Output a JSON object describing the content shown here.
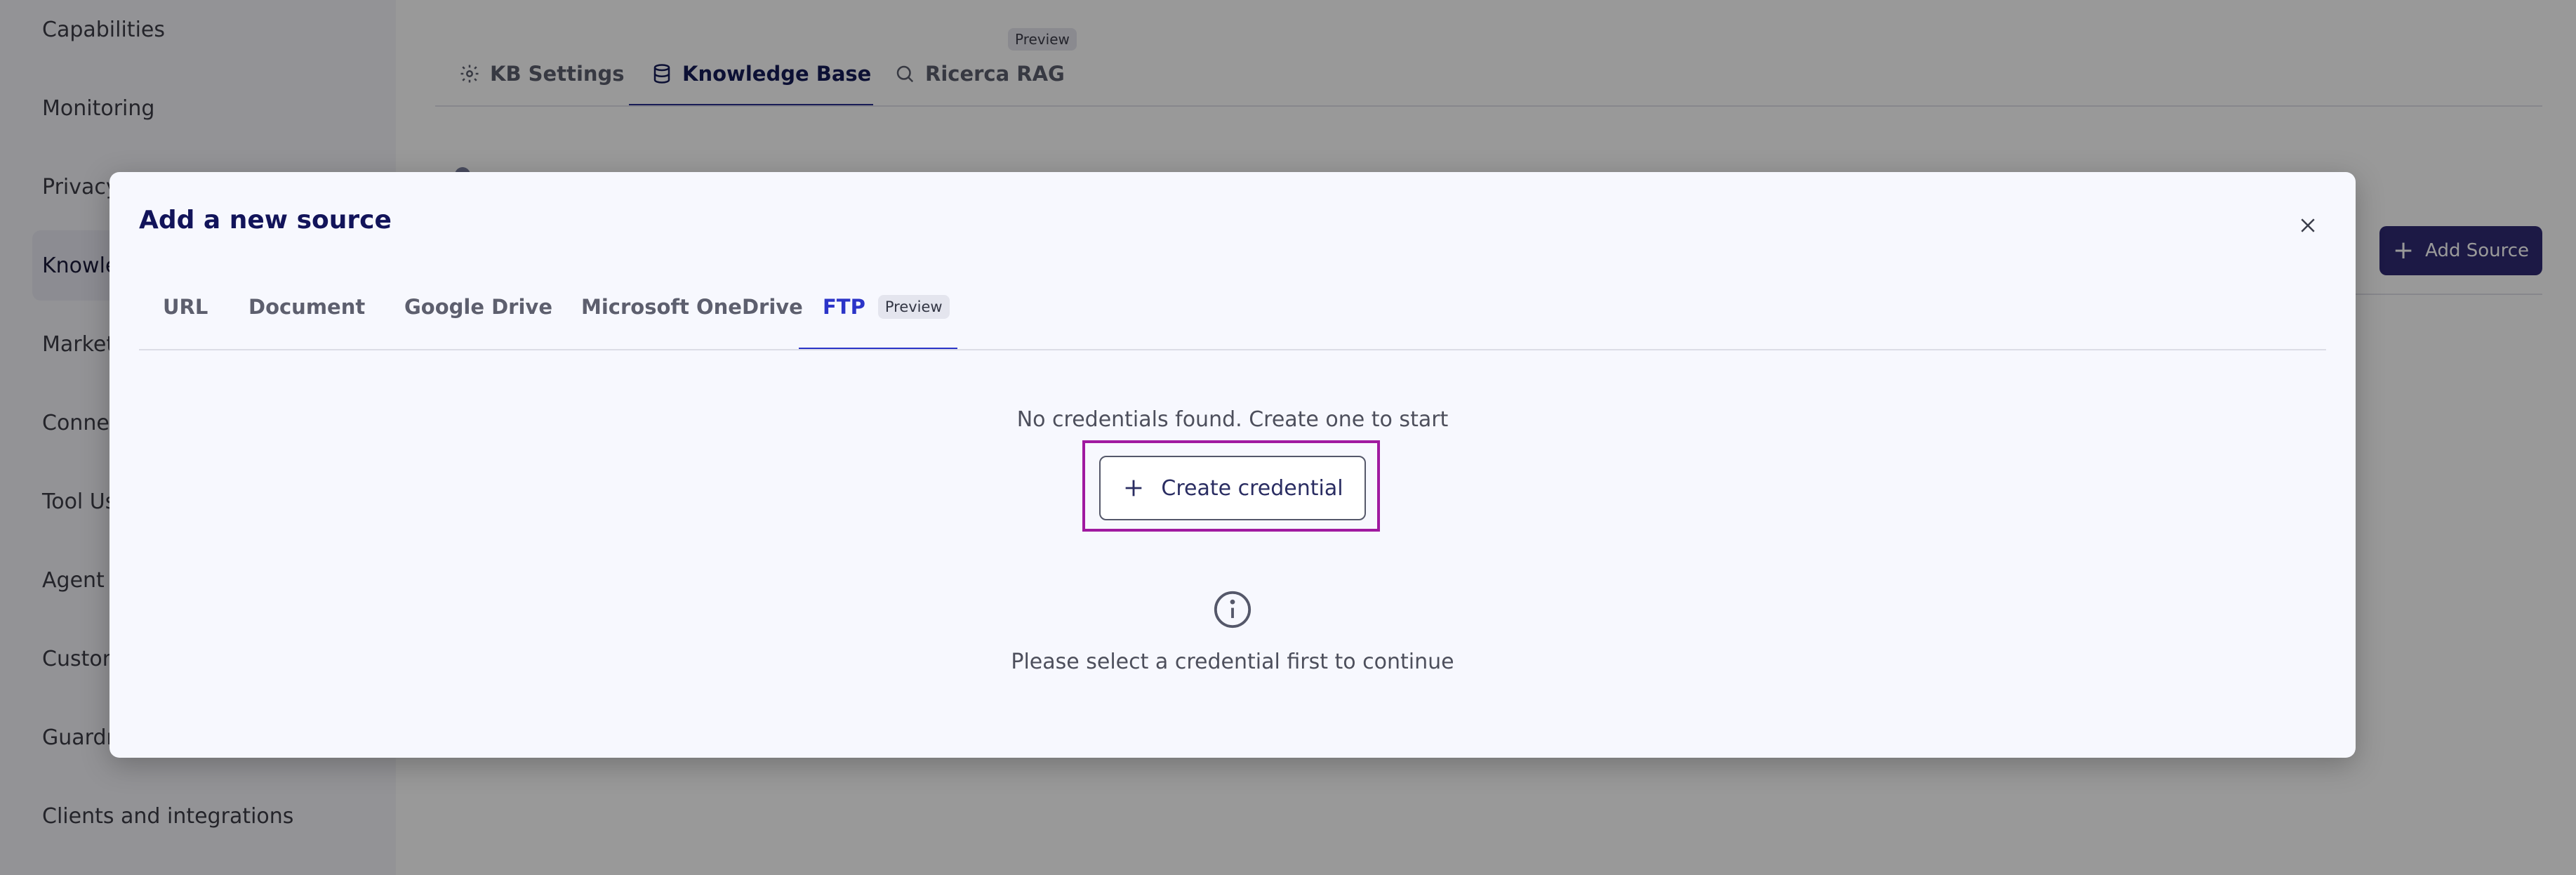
{
  "sidebar": {
    "items": [
      {
        "label": "Capabilities"
      },
      {
        "label": "Monitoring"
      },
      {
        "label": "Privacy"
      },
      {
        "label": "Knowledge"
      },
      {
        "label": "Market"
      },
      {
        "label": "Connec"
      },
      {
        "label": "Tool Us"
      },
      {
        "label": "Agent S"
      },
      {
        "label": "Custom"
      },
      {
        "label": "Guardr"
      },
      {
        "label": "Clients and integrations"
      }
    ]
  },
  "page": {
    "tabs": [
      {
        "label": "KB Settings",
        "icon": "gear-icon"
      },
      {
        "label": "Knowledge Base",
        "icon": "database-icon"
      },
      {
        "label": "Ricerca RAG",
        "icon": "search-icon",
        "badge": "Preview"
      }
    ],
    "add_source_label": "Add Source"
  },
  "modal": {
    "title": "Add a new source",
    "tabs": [
      {
        "label": "URL"
      },
      {
        "label": "Document"
      },
      {
        "label": "Google Drive"
      },
      {
        "label": "Microsoft OneDrive"
      },
      {
        "label": "FTP",
        "badge": "Preview"
      }
    ],
    "no_credentials_text": "No credentials found. Create one to start",
    "create_credential_label": "Create credential",
    "select_credential_text": "Please select a credential first to continue"
  },
  "colors": {
    "accent": "#2b34c8",
    "title": "#12145a",
    "primary_button": "#2f2b74",
    "highlight": "#a01aa0"
  }
}
